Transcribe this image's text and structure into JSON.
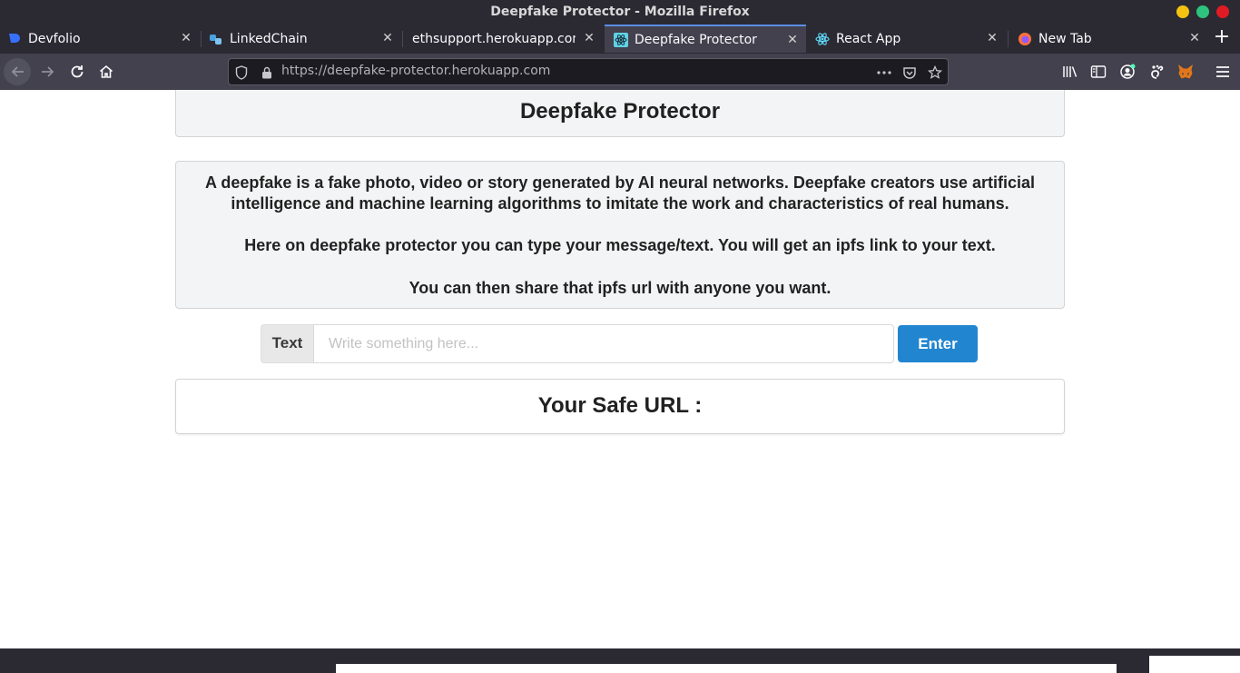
{
  "window": {
    "title": "Deepfake Protector - Mozilla Firefox"
  },
  "tabs": [
    {
      "label": "Devfolio",
      "icon": "devfolio-icon",
      "selected": false
    },
    {
      "label": "LinkedChain",
      "icon": "linkedchain-icon",
      "selected": false
    },
    {
      "label": "ethsupport.herokuapp.com/",
      "icon": "none",
      "selected": false
    },
    {
      "label": "Deepfake Protector",
      "icon": "react-icon",
      "selected": true
    },
    {
      "label": "React App",
      "icon": "react-icon",
      "selected": false
    },
    {
      "label": "New Tab",
      "icon": "firefox-icon",
      "selected": false
    }
  ],
  "navbar": {
    "url": "https://deepfake-protector.herokuapp.com"
  },
  "page": {
    "header_title": "Deepfake Protector",
    "info_paragraph_1": "A deepfake is a fake photo, video or story generated by AI neural networks. Deepfake creators use artificial intelligence and machine learning algorithms to imitate the work and characteristics of real humans.",
    "info_paragraph_2": "Here on deepfake protector you can type your message/text. You will get an ipfs link to your text.",
    "info_paragraph_3": "You can then share that ipfs url with anyone you want.",
    "input_label": "Text",
    "input_placeholder": "Write something here...",
    "input_value": "",
    "enter_button": "Enter",
    "safe_url_heading": "Your Safe URL :"
  },
  "colors": {
    "accent_button": "#2185d0",
    "card_background": "#f3f4f5",
    "browser_chrome": "#2b2a33"
  }
}
